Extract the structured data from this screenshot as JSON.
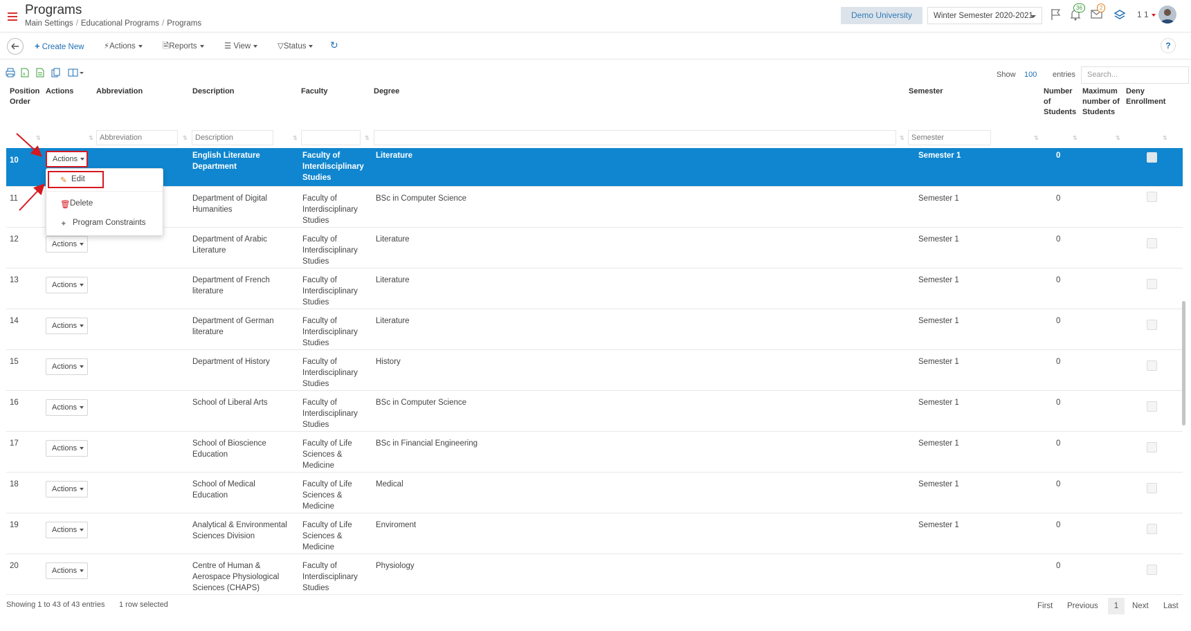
{
  "header": {
    "title": "Programs",
    "breadcrumb": [
      "Main Settings",
      "Educational Programs",
      "Programs"
    ],
    "university": "Demo University",
    "semester": "Winter Semester 2020-2021",
    "notif_badge": "36",
    "mail_badge": "2",
    "user_num": "1 1"
  },
  "toolbar": {
    "create_new": "Create New",
    "actions": "Actions",
    "reports": "Reports",
    "view": "View",
    "status": "Status",
    "help": "?"
  },
  "table_tools": {
    "show_label": "Show",
    "show_value": "100",
    "entries_label": "entries",
    "search_placeholder": "Search..."
  },
  "columns": {
    "position_order": "Position Order",
    "actions": "Actions",
    "abbreviation": "Abbreviation",
    "description": "Description",
    "faculty": "Faculty",
    "degree": "Degree",
    "semester": "Semester",
    "num_students": "Number of Students",
    "max_students": "Maximum number of Students",
    "deny_enrollment": "Deny Enrollment"
  },
  "filters": {
    "abbreviation": "Abbreviation",
    "description": "Description",
    "semester": "Semester"
  },
  "rows": [
    {
      "pos": "10",
      "action": "Actions",
      "desc": "English Literature Department",
      "faculty": "Faculty of Interdisciplinary Studies",
      "degree": "Literature",
      "semester": "Semester 1",
      "students": "0"
    },
    {
      "pos": "11",
      "action": "Actions",
      "desc": "Department of Digital Humanities",
      "faculty": "Faculty of Interdisciplinary Studies",
      "degree": "BSc in Computer Science",
      "semester": "Semester 1",
      "students": "0"
    },
    {
      "pos": "12",
      "action": "Actions",
      "desc": "Department of Arabic Literature",
      "faculty": "Faculty of Interdisciplinary Studies",
      "degree": "Literature",
      "semester": "Semester 1",
      "students": "0"
    },
    {
      "pos": "13",
      "action": "Actions",
      "desc": "Department of French literature",
      "faculty": "Faculty of Interdisciplinary Studies",
      "degree": "Literature",
      "semester": "Semester 1",
      "students": "0"
    },
    {
      "pos": "14",
      "action": "Actions",
      "desc": "Department of German literature",
      "faculty": "Faculty of Interdisciplinary Studies",
      "degree": "Literature",
      "semester": "Semester 1",
      "students": "0"
    },
    {
      "pos": "15",
      "action": "Actions",
      "desc": "Department of History",
      "faculty": "Faculty of Interdisciplinary Studies",
      "degree": "History",
      "semester": "Semester 1",
      "students": "0"
    },
    {
      "pos": "16",
      "action": "Actions",
      "desc": "School of Liberal Arts",
      "faculty": "Faculty of Interdisciplinary Studies",
      "degree": "BSc in Computer Science",
      "semester": "Semester 1",
      "students": "0"
    },
    {
      "pos": "17",
      "action": "Actions",
      "desc": "School of Bioscience Education",
      "faculty": "Faculty of Life Sciences & Medicine",
      "degree": "BSc in Financial Engineering",
      "semester": "Semester 1",
      "students": "0"
    },
    {
      "pos": "18",
      "action": "Actions",
      "desc": "School of Medical Education",
      "faculty": "Faculty of Life Sciences & Medicine",
      "degree": "Medical",
      "semester": "Semester 1",
      "students": "0"
    },
    {
      "pos": "19",
      "action": "Actions",
      "desc": "Analytical & Environmental Sciences Division",
      "faculty": "Faculty of Life Sciences & Medicine",
      "degree": "Enviroment",
      "semester": "Semester 1",
      "students": "0"
    },
    {
      "pos": "20",
      "action": "Actions",
      "desc": "Centre of Human & Aerospace Physiological Sciences (CHAPS)",
      "faculty": "Faculty of Interdisciplinary Studies",
      "degree": "Physiology",
      "semester": "",
      "students": "0"
    }
  ],
  "dropdown": {
    "edit": "Edit",
    "delete": "Delete",
    "constraints": "Program Constraints"
  },
  "footer": {
    "showing": "Showing 1 to 43 of 43 entries",
    "selected": "1 row selected",
    "first": "First",
    "previous": "Previous",
    "page": "1",
    "next": "Next",
    "last": "Last"
  },
  "colors": {
    "selected_row": "#0f86cf",
    "accent_blue": "#1f6fb5",
    "annotation_red": "#d6181f"
  }
}
